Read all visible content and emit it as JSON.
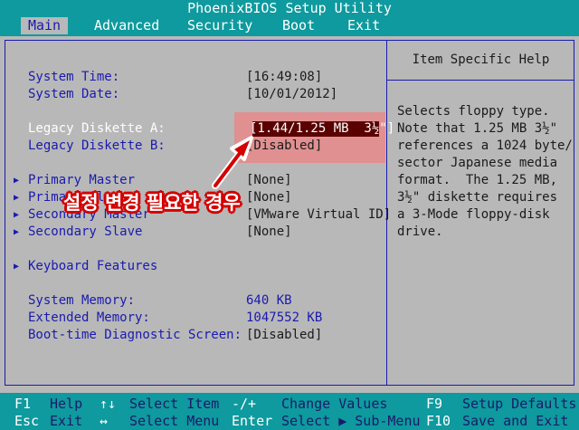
{
  "title": "PhoenixBIOS Setup Utility",
  "menu": [
    "Main",
    "Advanced",
    "Security",
    "Boot",
    "Exit"
  ],
  "main": {
    "system_time_label": "System Time:",
    "system_time_value": "[16:49:08]",
    "system_date_label": "System Date:",
    "system_date_value": "[10/01/2012]",
    "legacy_a_label": "Legacy Diskette A:",
    "legacy_a_value": "[1.44/1.25 MB  3½\"]",
    "legacy_b_label": "Legacy Diskette B:",
    "legacy_b_value": "[Disabled]",
    "primary_master_label": "Primary Master",
    "primary_master_value": "[None]",
    "primary_slave_label": "Primary Slave",
    "primary_slave_value": "[None]",
    "secondary_master_label": "Secondary Master",
    "secondary_master_value": "[VMware Virtual ID]",
    "secondary_slave_label": "Secondary Slave",
    "secondary_slave_value": "[None]",
    "keyboard_features_label": "Keyboard Features",
    "system_memory_label": "System Memory:",
    "system_memory_value": "640 KB",
    "extended_memory_label": "Extended Memory:",
    "extended_memory_value": "1047552 KB",
    "boot_diag_label": "Boot-time Diagnostic Screen:",
    "boot_diag_value": "[Disabled]",
    "submenu_marker": "▶"
  },
  "help": {
    "title": "Item Specific Help",
    "lines": [
      "Selects floppy type.",
      "Note that 1.25 MB 3½\"",
      "references a 1024 byte/",
      "sector Japanese media",
      "format.  The 1.25 MB,",
      "3½\" diskette requires",
      "a 3-Mode floppy-disk",
      "drive."
    ]
  },
  "callout": "설정 변경 필요한 경우",
  "footer": {
    "row1": [
      {
        "key": "F1",
        "text": "Help"
      },
      {
        "key": "↑↓",
        "text": "Select Item"
      },
      {
        "key": "-/+",
        "text": "Change Values"
      },
      {
        "key": "F9",
        "text": "Setup Defaults"
      }
    ],
    "row2": [
      {
        "key": "Esc",
        "text": "Exit"
      },
      {
        "key": "↔",
        "text": "Select Menu"
      },
      {
        "key": "Enter",
        "text": "Select ▶ Sub-Menu"
      },
      {
        "key": "F10",
        "text": "Save and Exit"
      }
    ]
  },
  "colors": {
    "bar": "#0e9a9e",
    "background": "#b8b8b8",
    "text": "#1a1ab0",
    "highlight": "#e68888",
    "callout": "#d40000"
  }
}
